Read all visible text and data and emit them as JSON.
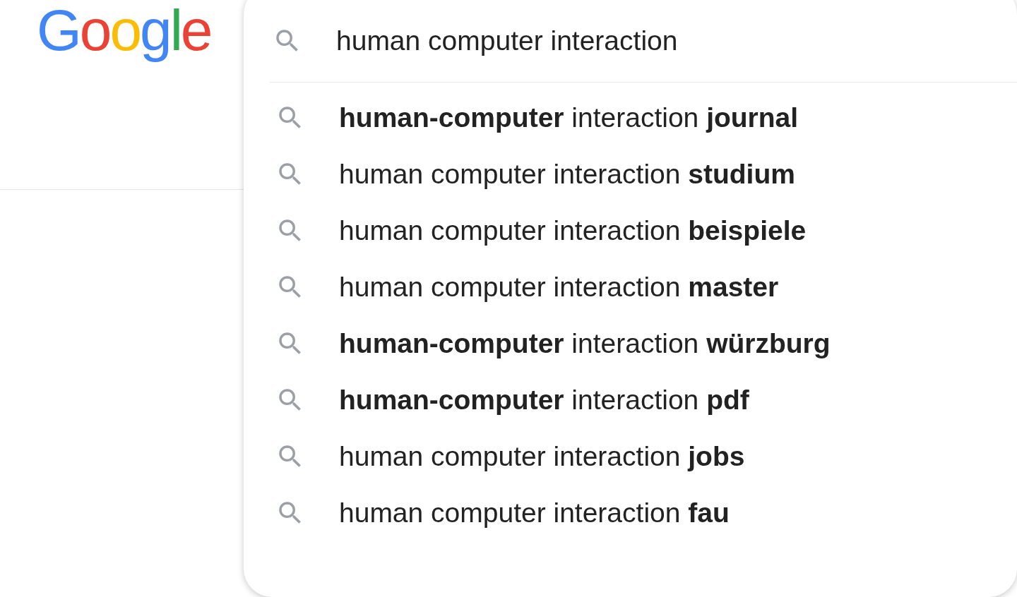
{
  "logo": {
    "text": "Google"
  },
  "search": {
    "value": "human computer interaction"
  },
  "suggestions": [
    "**human-computer** interaction **journal**",
    "human computer interaction **studium**",
    "human computer interaction **beispiele**",
    "human computer interaction **master**",
    "**human-computer** interaction **würzburg**",
    "**human-computer** interaction **pdf**",
    "human computer interaction **jobs**",
    "human computer interaction **fau**"
  ]
}
